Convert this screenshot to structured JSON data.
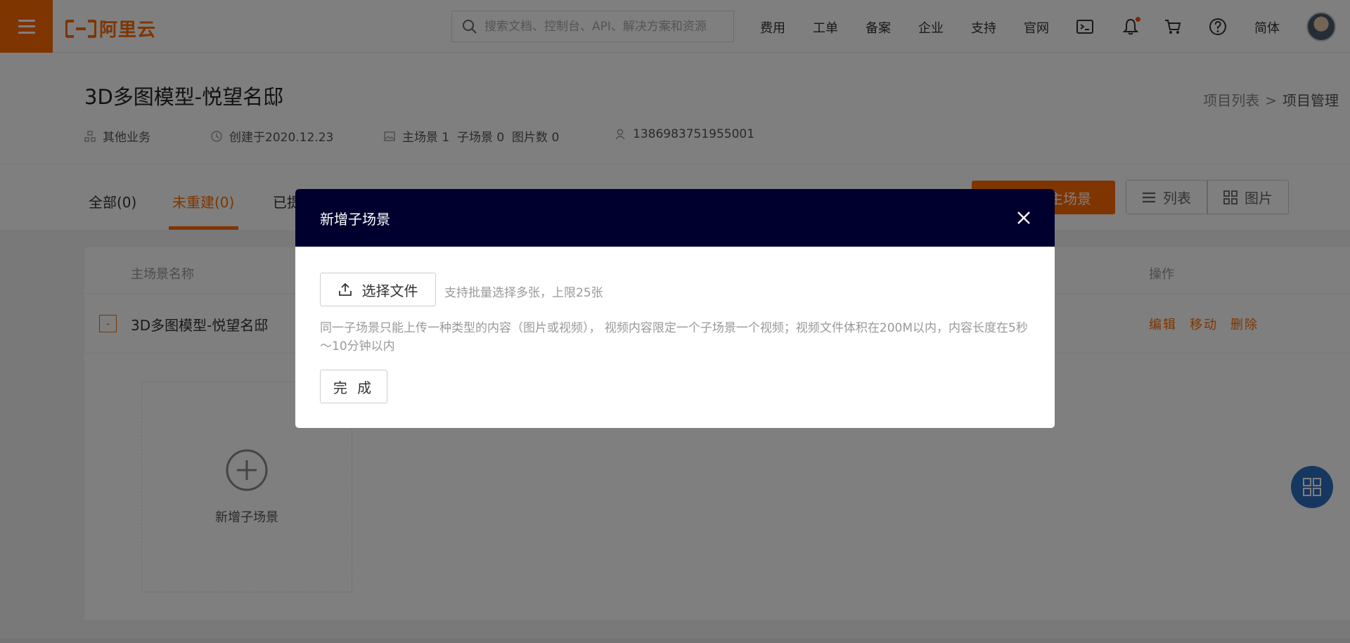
{
  "topbar": {
    "logo_text": "阿里云",
    "search_placeholder": "搜索文档、控制台、API、解决方案和资源",
    "nav_items": [
      "费用",
      "工单",
      "备案",
      "企业",
      "支持",
      "官网"
    ],
    "lang_label": "简体",
    "icons": [
      "terminal-icon",
      "bell-icon",
      "cart-icon",
      "help-icon"
    ],
    "brand_color": "#ff6a00"
  },
  "project": {
    "title": "3D多图模型-悦望名邸",
    "business": "其他业务",
    "created": "创建于2020.12.23",
    "scenes": "主场景 1  子场景 0  图片数 0",
    "user_id": "1386983751955001"
  },
  "breadcrumb": {
    "parent": "项目列表",
    "separator": ">",
    "current": "项目管理"
  },
  "tabs": [
    {
      "label": "全部(0)",
      "active": false
    },
    {
      "label": "未重建(0)",
      "active": true
    },
    {
      "label": "已提",
      "active": false
    }
  ],
  "actions": {
    "add_main_scene": "主场景",
    "view_list": "列表",
    "view_grid": "图片"
  },
  "table": {
    "headers": {
      "name": "主场景名称",
      "ops": "操作"
    },
    "rows": [
      {
        "collapse": "-",
        "name": "3D多图模型-悦望名邸",
        "ops": [
          "编辑",
          "移动",
          "删除"
        ]
      }
    ],
    "add_sub_scene_label": "新增子场景"
  },
  "modal": {
    "title": "新增子场景",
    "upload_button": "选择文件",
    "upload_hint": "支持批量选择多张，上限25张",
    "note": "同一子场景只能上传一种类型的内容（图片或视频）， 视频内容限定一个子场景一个视频；视频文件体积在200M以内，内容长度在5秒～10分钟以内",
    "done_button": "完 成",
    "header_color": "#00002e"
  }
}
